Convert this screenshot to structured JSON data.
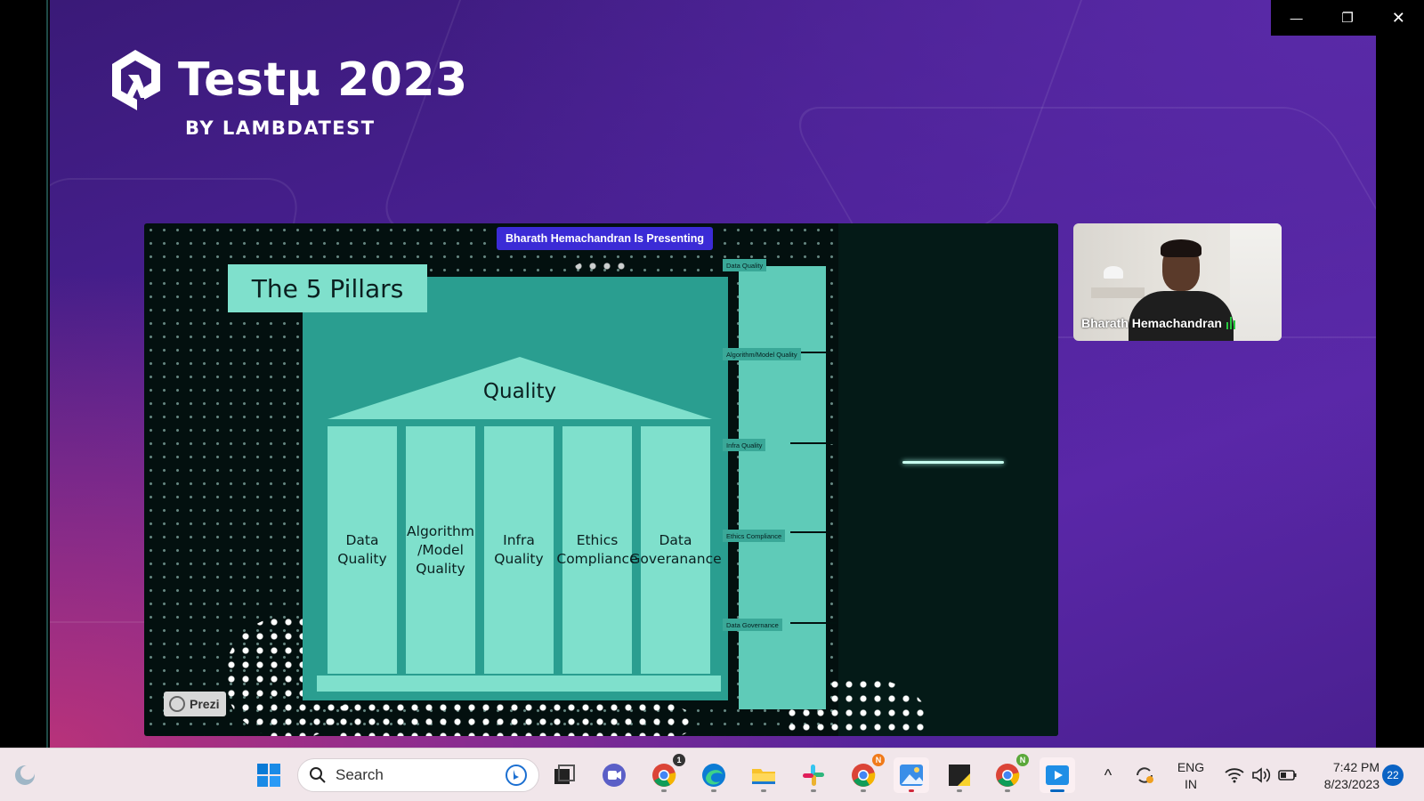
{
  "window": {
    "controls": {
      "minimize": "—",
      "restore": "❐",
      "close": "✕"
    }
  },
  "logo": {
    "title": "Testμ 2023",
    "subtitle": "BY LAMBDATEST",
    "icon": "lambdatest-logo-icon"
  },
  "presentation": {
    "presenting_badge": "Bharath Hemachandran Is Presenting",
    "slide": {
      "title": "The 5 Pillars",
      "roof_label": "Quality",
      "pillars": [
        "Data\nQuality",
        "Algorithm\n/Model\nQuality",
        "Infra\nQuality",
        "Ethics\nCompliance",
        "Data\nGoveranance"
      ],
      "side_labels": [
        "Data Quality",
        "Algorithm/Model Quality",
        "Infra Quality",
        "Ethics Compliance",
        "Data Governance"
      ]
    },
    "prezi_label": "Prezi"
  },
  "video": {
    "participant_name": "Bharath Hemachandran",
    "mic_icon": "speaking-indicator-icon"
  },
  "taskbar": {
    "search_placeholder": "Search",
    "language_line1": "ENG",
    "language_line2": "IN",
    "time": "7:42 PM",
    "date": "8/23/2023",
    "notification_count": "22",
    "app_badges": {
      "chrome_1": "1",
      "chrome_2": "N",
      "chrome_3": "N"
    }
  },
  "colors": {
    "accent_teal": "#7fe0cc",
    "badge_blue": "#3b2bd6",
    "stage_purple": "#4b2196"
  }
}
